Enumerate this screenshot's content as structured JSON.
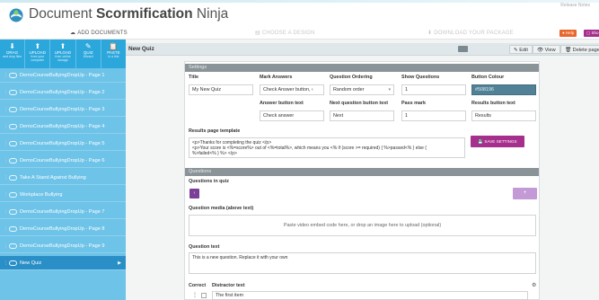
{
  "app": {
    "title_regular": "Document ",
    "title_bold": "Scormification",
    "title_suffix": " Ninja",
    "top_right_link": "Release Notes"
  },
  "steps": [
    {
      "icon": "☁",
      "label": "ADD DOCUMENTS",
      "active": true
    },
    {
      "icon": "▤",
      "label": "CHOOSE A DESIGN",
      "active": false
    },
    {
      "icon": "⬇",
      "label": "DOWNLOAD YOUR PACKAGE",
      "active": false
    }
  ],
  "toolbar": [
    {
      "icon": "⬇",
      "label": "DRAG",
      "sub": "and drop files"
    },
    {
      "icon": "⬆",
      "label": "UPLOAD",
      "sub": "from your computer"
    },
    {
      "icon": "⬆",
      "label": "UPLOAD",
      "sub": "from online storage"
    },
    {
      "icon": "✎",
      "label": "QUIZ",
      "sub": "Wizard"
    },
    {
      "icon": "📋",
      "label": "PASTE",
      "sub": "in a link"
    }
  ],
  "sidebar": [
    {
      "label": "DemoCourseBullyingDropUp - Page 1",
      "active": false
    },
    {
      "label": "DemoCourseBullyingDropUp - Page 2",
      "active": false
    },
    {
      "label": "DemoCourseBullyingDropUp - Page 3",
      "active": false
    },
    {
      "label": "DemoCourseBullyingDropUp - Page 4",
      "active": false
    },
    {
      "label": "DemoCourseBullyingDropUp - Page 5",
      "active": false
    },
    {
      "label": "DemoCourseBullyingDropUp - Page 6",
      "active": false
    },
    {
      "label": "Take A Stand Against Bullying",
      "active": false
    },
    {
      "label": "Workplace Bullying",
      "active": false
    },
    {
      "label": "DemoCourseBullyingDropUp - Page 7",
      "active": false
    },
    {
      "label": "DemoCourseBullyingDropUp - Page 8",
      "active": false
    },
    {
      "label": "DemoCourseBullyingDropUp - Page 9",
      "active": false
    },
    {
      "label": "New Quiz",
      "active": true
    }
  ],
  "quiz_bar": {
    "name": "New Quiz",
    "edit_label": "✎ Edit",
    "view_label": "👁 View",
    "delete_label": "🗑 Delete page",
    "help_label": "● Help",
    "extra_label": "▢ Sho"
  },
  "settings": {
    "section_label": "Settings",
    "title_label": "Title",
    "title_value": "My New Quiz",
    "mark_answers_label": "Mark Answers",
    "mark_answers_value": "Check Answer button, ‹",
    "question_ordering_label": "Question Ordering",
    "question_ordering_value": "Random order",
    "show_questions_label": "Show Questions",
    "show_questions_value": "1",
    "button_colour_label": "Button Colour",
    "button_colour_value": "#508196",
    "answer_button_label": "Answer button text",
    "answer_button_value": "Check answer",
    "next_button_label": "Next question button text",
    "next_button_value": "Next",
    "pass_mark_label": "Pass mark",
    "pass_mark_value": "1",
    "results_button_label": "Results button text",
    "results_button_value": "Results",
    "results_template_label": "Results page template",
    "results_template_line1": "<p>Thanks for completing the quiz </p>",
    "results_template_line2": "<p>Your score is <%=score%> out of <%=total%>, which means you <% if (score >= required) { %>passed<% } else {",
    "results_template_line3": "%>failed<% } %> </p>",
    "save_label": "💾 SAVE SETTINGS"
  },
  "questions": {
    "section_label": "Questions",
    "in_quiz_label": "Questions in quiz",
    "nav_icon": "‹",
    "add_icon": "+",
    "media_label": "Question media (above text)",
    "media_placeholder": "Paste video embed code here, or drop an image here to upload (optional)",
    "text_label": "Question text",
    "text_value": "This is a new question. Replace it with your own",
    "correct_label": "Correct",
    "distractor_label": "Distractor text",
    "first_item": "The first item"
  },
  "colors": {
    "brand_blue": "#2ca7dc",
    "sidebar_blue": "#6ec3e8",
    "active_blue": "#2a8fc7",
    "purple": "#a62e8d",
    "help_orange": "#e8672c",
    "header_grey": "#8a9397"
  }
}
